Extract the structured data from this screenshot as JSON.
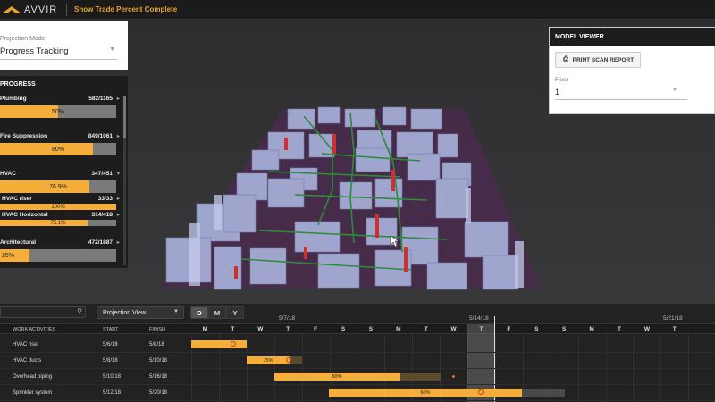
{
  "app": {
    "logo_text": "AVVIR",
    "top_link": "Show Trade Percent Complete"
  },
  "projection": {
    "label": "Projection Mode",
    "value": "Progress Tracking"
  },
  "progress": {
    "title": "PROGRESS",
    "rows": [
      {
        "name": "Plumbing",
        "count": "582/1165",
        "percent_label": "50%",
        "fraction": 0.5
      },
      {
        "name": "Fire Suppression",
        "count": "849/1061",
        "percent_label": "80%",
        "fraction": 0.8
      },
      {
        "name": "HVAC",
        "count": "347/451",
        "percent_label": "76.9%",
        "fraction": 0.769
      },
      {
        "name": "HVAC riser",
        "count": "33/33",
        "percent_label": "100%",
        "fraction": 1.0
      },
      {
        "name": "HVAC Horizontal",
        "count": "314/418",
        "percent_label": "75.1%",
        "fraction": 0.751
      },
      {
        "name": "Architectural",
        "count": "472/1887",
        "percent_label": "25%",
        "fraction": 0.25
      }
    ]
  },
  "model_viewer": {
    "title": "MODEL VIEWER",
    "print_button": "PRINT SCAN REPORT",
    "floor_label": "Floor",
    "floor_value": "1"
  },
  "gantt": {
    "view_select": "Projection View",
    "scale_buttons": [
      "D",
      "M",
      "Y"
    ],
    "active_scale": "D",
    "week_dates": [
      "5/7/18",
      "5/14/18",
      "5/21/18"
    ],
    "columns": {
      "activities": "WORK ACTIVITIES",
      "start": "START",
      "finish": "FINISH"
    },
    "days": [
      "M",
      "T",
      "W",
      "T",
      "F",
      "S",
      "S",
      "M",
      "T",
      "W",
      "T",
      "F",
      "S",
      "S",
      "M",
      "T",
      "W",
      "T"
    ],
    "rows": [
      {
        "name": "HVAC riser",
        "start": "5/6/18",
        "finish": "5/8/18",
        "bar_label": ""
      },
      {
        "name": "HVAC ducts",
        "start": "5/8/18",
        "finish": "5/10/18",
        "bar_label": "75%"
      },
      {
        "name": "Overhead piping",
        "start": "5/10/18",
        "finish": "5/16/18",
        "bar_label": "50%"
      },
      {
        "name": "Sprinkler system",
        "start": "5/12/18",
        "finish": "5/20/18",
        "bar_label": "60%"
      }
    ]
  },
  "colors": {
    "accent": "#f5ad3b",
    "panel_dark": "#1d1d1d",
    "progress_track": "#7a7a7a"
  }
}
